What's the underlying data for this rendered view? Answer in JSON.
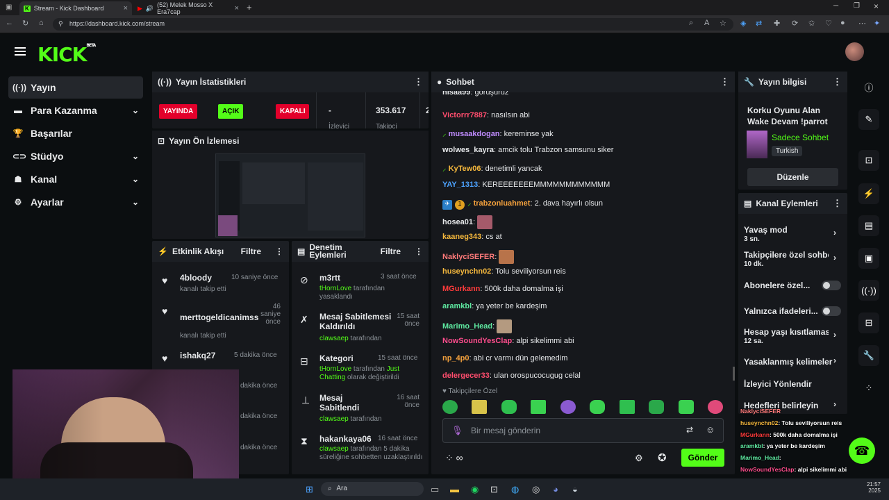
{
  "browser": {
    "tabs": [
      {
        "label": "Stream - Kick Dashboard"
      },
      {
        "label": "(52) Melek Mosso X Era7cap"
      }
    ],
    "url": "https://dashboard.kick.com/stream"
  },
  "brand": {
    "logo": "KICK",
    "badge": "BETA",
    "accent": "#53fc18"
  },
  "sidebar": {
    "items": [
      {
        "label": "Yayın",
        "icon": "broadcast-icon"
      },
      {
        "label": "Para Kazanma",
        "icon": "money-icon"
      },
      {
        "label": "Başarılar",
        "icon": "trophy-icon"
      },
      {
        "label": "Stüdyo",
        "icon": "studio-icon"
      },
      {
        "label": "Kanal",
        "icon": "channel-icon"
      },
      {
        "label": "Ayarlar",
        "icon": "settings-icon"
      }
    ]
  },
  "stats": {
    "title": "Yayın İstatistikleri",
    "live": "YAYINDA",
    "open": "AÇIK",
    "closed": "KAPALI",
    "viewers_value": "-",
    "viewers_label": "İzleyici",
    "followers_value": "353.617",
    "followers_label": "Takipçi",
    "extra_value": "2"
  },
  "preview": {
    "title": "Yayın Ön İzlemesi"
  },
  "activity": {
    "title": "Etkinlik Akışı",
    "filter": "Filtre",
    "items": [
      {
        "name": "4bloody",
        "time": "10 saniye önce",
        "text": "kanalı takip etti"
      },
      {
        "name": "merttogeldicanimss",
        "time": "46 saniye önce",
        "text": "kanalı takip etti"
      },
      {
        "name": "ishakq27",
        "time": "5 dakika önce",
        "text": ""
      },
      {
        "time": "dakika önce"
      },
      {
        "time": "dakika önce"
      },
      {
        "time": "dakika önce"
      }
    ]
  },
  "moderation": {
    "title": "Denetim Eylemleri",
    "filter": "Filtre",
    "items": [
      {
        "title": "m3rtt",
        "time": "3 saat önce",
        "actor": "tHornLove",
        "rest": "tarafından yasaklandı"
      },
      {
        "title": "Mesaj Sabitlemesi Kaldırıldı",
        "time": "15 saat önce",
        "actor": "clawsaep",
        "rest": "tarafından"
      },
      {
        "title": "Kategori",
        "time": "15 saat önce",
        "actor": "tHornLove",
        "rest": "tarafından",
        "highlight": "Just Chatting",
        "rest2": "olarak değiştirildi"
      },
      {
        "title": "Mesaj Sabitlendi",
        "time": "16 saat önce",
        "actor": "clawsaep",
        "rest": "tarafından"
      },
      {
        "title": "hakankaya06",
        "time": "16 saat önce",
        "actor": "clawsaep",
        "rest": "tarafından 5 dakika süreliğine sohbetten uzaklaştırıldı"
      }
    ]
  },
  "chat": {
    "title": "Sohbet",
    "messages": [
      {
        "user": "nisaa99",
        "color": "#e6e8ea",
        "text": "görüşürüz"
      },
      {
        "user": "Victorrr7887",
        "color": "#ff4d6d",
        "text": "nasılsın abi"
      },
      {
        "user": "musaakdogan",
        "color": "#c08cff",
        "text": "kereminse yak"
      },
      {
        "user": "wolwes_kayra",
        "color": "#e6e8ea",
        "text": "amcik tolu Trabzon samsunu siker"
      },
      {
        "user": "KyTew06",
        "color": "#f5b83d",
        "text": "denetimli yancak"
      },
      {
        "user": "YAY_1313",
        "color": "#4da3ff",
        "text": "KEREEEEEEEMMMMMMMMMMMM"
      },
      {
        "user": "trabzonluahmet",
        "color": "#f5a23d",
        "text": "2. dava hayırlı olsun",
        "badge": "1"
      },
      {
        "user": "hosea01",
        "color": "#e6e8ea",
        "text": ""
      },
      {
        "user": "kaaneg343",
        "color": "#f5b83d",
        "text": "cs at"
      },
      {
        "user": "NaklyciSEFER",
        "color": "#ff7a7a",
        "text": ""
      },
      {
        "user": "huseynchn02",
        "color": "#f5b83d",
        "text": "Tolu seviliyorsun reis"
      },
      {
        "user": "MGurkann",
        "color": "#ff3b3b",
        "text": "500k daha domalma işi"
      },
      {
        "user": "aramkbl",
        "color": "#5ee8a0",
        "text": "ya yeter be kardeşim"
      },
      {
        "user": "Marimo_Head",
        "color": "#5ee8a0",
        "text": ""
      },
      {
        "user": "NowSoundYesClap",
        "color": "#ff4d8d",
        "text": "alpi sikelimmi abi"
      },
      {
        "user": "np_4p0",
        "color": "#f5a23d",
        "text": "abi cr varmı dün gelemedim"
      },
      {
        "user": "delergecer33",
        "color": "#ff4d6d",
        "text": "ulan orospucocugug celal"
      }
    ],
    "followers_only": "Takipçilere Özel",
    "input_placeholder": "Bir mesaj gönderin",
    "send": "Gönder"
  },
  "info": {
    "title": "Yayın bilgisi",
    "stream_title": "Korku Oyunu Alan Wake Devam !parrot",
    "category": "Sadece Sohbet",
    "language": "Turkish",
    "edit": "Düzenle"
  },
  "channel_actions": {
    "title": "Kanal Eylemleri",
    "items": [
      {
        "label": "Yavaş mod",
        "sub": "3 sn."
      },
      {
        "label": "Takipçilere özel sohbet",
        "sub": "10 dk."
      },
      {
        "label": "Abonelere özel..."
      },
      {
        "label": "Yalnızca ifadeleri..."
      },
      {
        "label": "Hesap yaşı kısıtlaması",
        "sub": "12 sa."
      },
      {
        "label": "Yasaklanmış kelimeler"
      },
      {
        "label": "İzleyici Yönlendir"
      },
      {
        "label": "Hedefleri belirleyin"
      }
    ]
  },
  "overlay_chat": [
    {
      "user": "NaklyciSEFER",
      "color": "#ff7a7a",
      "text": ""
    },
    {
      "user": "huseynchn02",
      "color": "#f5b83d",
      "text": ": Tolu seviliyorsun reis"
    },
    {
      "user": "MGurkann",
      "color": "#ff3b3b",
      "text": ": 500k daha domalma işi"
    },
    {
      "user": "aramkbl",
      "color": "#5ee8a0",
      "text": ": ya yeter be kardeşim"
    },
    {
      "user": "Marimo_Head",
      "color": "#5ee8a0",
      "text": ":"
    },
    {
      "user": "NowSoundYesClap",
      "color": "#ff4d8d",
      "text": ": alpi sikelimmi abi"
    },
    {
      "user": "np_4p0",
      "color": "#f5a23d",
      "text": ": abi cr varmı dün gelemedim"
    },
    {
      "user": "delergecer33",
      "color": "#ff4d6d",
      "text": ": ulan orospucocugug celal"
    }
  ],
  "taskbar": {
    "search": "Ara",
    "time": "21:57",
    "date": "2025"
  }
}
